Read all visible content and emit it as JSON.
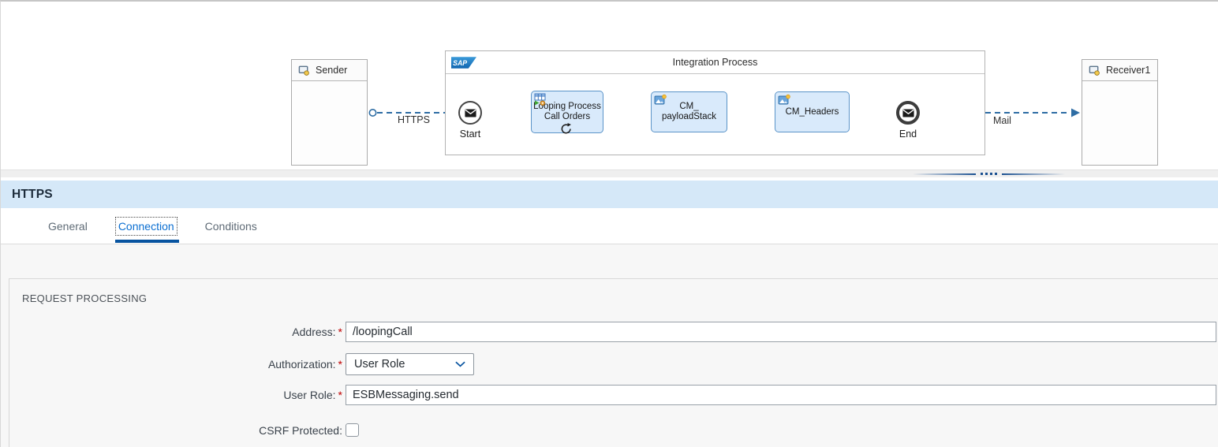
{
  "diagram": {
    "sender": {
      "label": "Sender"
    },
    "receiver": {
      "label": "Receiver1"
    },
    "process": {
      "title": "Integration Process",
      "logo": "SAP"
    },
    "start": {
      "label": "Start"
    },
    "end": {
      "label": "End"
    },
    "flows": {
      "inbound_label": "HTTPS",
      "outbound_label": "Mail"
    },
    "tasks": [
      {
        "name": "Looping Process Call Orders",
        "line1": "Looping Process",
        "line2": "Call Orders",
        "icon": "process-call-icon",
        "loop": true
      },
      {
        "name": "CM_payloadStack",
        "line1": "CM_",
        "line2": "payloadStack",
        "icon": "content-modifier-icon",
        "loop": false
      },
      {
        "name": "CM_Headers",
        "line1": "CM_Headers",
        "line2": "",
        "icon": "content-modifier-icon",
        "loop": false
      }
    ]
  },
  "panel": {
    "title": "HTTPS",
    "tabs": [
      {
        "label": "General",
        "active": false
      },
      {
        "label": "Connection",
        "active": true
      },
      {
        "label": "Conditions",
        "active": false
      }
    ],
    "section_title": "REQUEST PROCESSING",
    "required_marker": "*",
    "fields": {
      "address": {
        "label": "Address:",
        "required": true,
        "value": "/loopingCall"
      },
      "authorization": {
        "label": "Authorization:",
        "required": true,
        "value": "User Role"
      },
      "user_role": {
        "label": "User Role:",
        "required": true,
        "value": "ESBMessaging.send"
      },
      "csrf": {
        "label": "CSRF Protected:",
        "required": false,
        "checked": false
      }
    }
  },
  "colors": {
    "accent": "#0a6ed1",
    "tab_underline": "#0854a0",
    "required": "#c00000",
    "task_fill": "#d9eafb",
    "task_border": "#5b94c8",
    "connector": "#2e6da4",
    "panel_header_band": "#d5e8f8"
  }
}
